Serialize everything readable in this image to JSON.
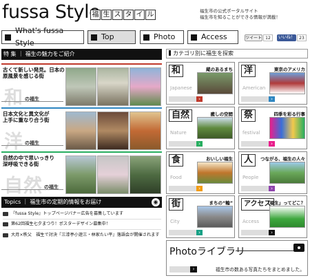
{
  "header": {
    "logo": "fussa Style",
    "subtitle_chars": [
      "福",
      "生",
      "ス",
      "タ",
      "イ",
      "ル"
    ],
    "tagline_line1": "福生市の公式ポータルサイト",
    "tagline_line2": "福生市を知ることができる情報が満載！"
  },
  "nav": {
    "items": [
      "What's fussa Style",
      "Top",
      "Photo",
      "Access"
    ],
    "active": "Top"
  },
  "social": {
    "tweet_label": "ツイート",
    "tweet_count": "12",
    "like_label": "いいね！",
    "like_count": "23"
  },
  "tokushu": {
    "heading": "特 集 ｜ 福生の魅力をご紹介",
    "features": [
      {
        "line1": "古くて新しい発見。日本の",
        "line2": "原風景を感じる街",
        "big": "和",
        "sub": "の福生",
        "accent": "#c0392b"
      },
      {
        "line1": "日本文化と異文化が",
        "line2": "上手に重なり合う街",
        "big": "洋",
        "sub": "の福生",
        "accent": "#2e86c1"
      },
      {
        "line1": "自然の中で思いっきり",
        "line2": "深呼吸できる街",
        "big": "自然",
        "sub": "の福生",
        "accent": "#27ae60"
      }
    ]
  },
  "topics": {
    "heading": "Topics ｜ 福生市の定期的情報をお届け",
    "items": [
      "『fussa Style』トップページバナー広告を募集しています",
      "第62回福生七夕まつり！ポスターデザイン募集中！",
      "大月×秩父　福生で対決『三漆亭小遊三・林家たい平』落語会が開催されます"
    ]
  },
  "category": {
    "heading": "カテゴリ別に福生を探索",
    "items": [
      {
        "kanji": "和",
        "en": "Japanese",
        "title": "蔵のあるまち",
        "color": "#c0392b"
      },
      {
        "kanji": "洋",
        "en": "American",
        "title": "東京のアメリカ",
        "color": "#2e86c1"
      },
      {
        "kanji": "自然",
        "en": "Nature",
        "title": "癒しの空間",
        "color": "#27ae60"
      },
      {
        "kanji": "祭",
        "en": "festival",
        "title": "四季を彩る行事",
        "color": "#e91e8c"
      },
      {
        "kanji": "食",
        "en": "Food",
        "title": "おいしい福生",
        "color": "#f39c12"
      },
      {
        "kanji": "人",
        "en": "People",
        "title": "つながる、福生の人々",
        "color": "#8e44ad"
      },
      {
        "kanji": "街",
        "en": "City",
        "title": "まちの“輪”",
        "color": "#16a085"
      },
      {
        "kanji": "アクセス",
        "en": "Access",
        "title": "「福生」ってどこ？",
        "color": "#111111"
      }
    ]
  },
  "photo_library": {
    "title": "Photoライブラリ",
    "desc": "福生市の数ある写真たちをまとめました。"
  },
  "colors": {
    "black": "#111111",
    "bar_gray": "#dddddd"
  }
}
